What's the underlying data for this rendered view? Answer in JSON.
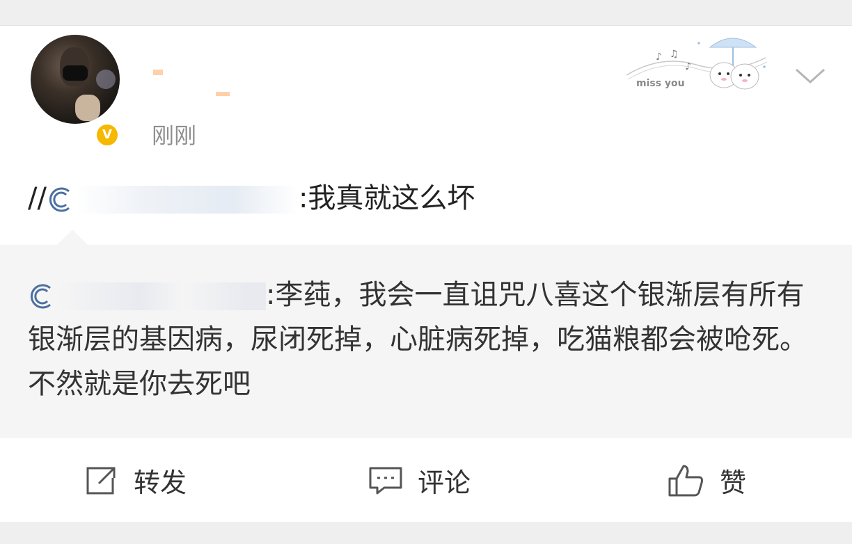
{
  "post": {
    "timestamp": "刚刚",
    "verified_badge": "V",
    "repost_prefix": "//",
    "repost_text": ":我真就这么坏",
    "quoted_text": ":李莼，我会一直诅咒八喜这个银渐层有所有银渐层的基因病，尿闭死掉，心脏病死掉，吃猫粮都会被呛死。不然就是你去死吧"
  },
  "decor": {
    "text": "miss you"
  },
  "actions": {
    "repost_label": "转发",
    "comment_label": "评论",
    "like_label": "赞"
  },
  "colors": {
    "badge": "#f6b800",
    "mention_icon": "#4b6fa0",
    "timestamp": "#8f8f8f"
  }
}
